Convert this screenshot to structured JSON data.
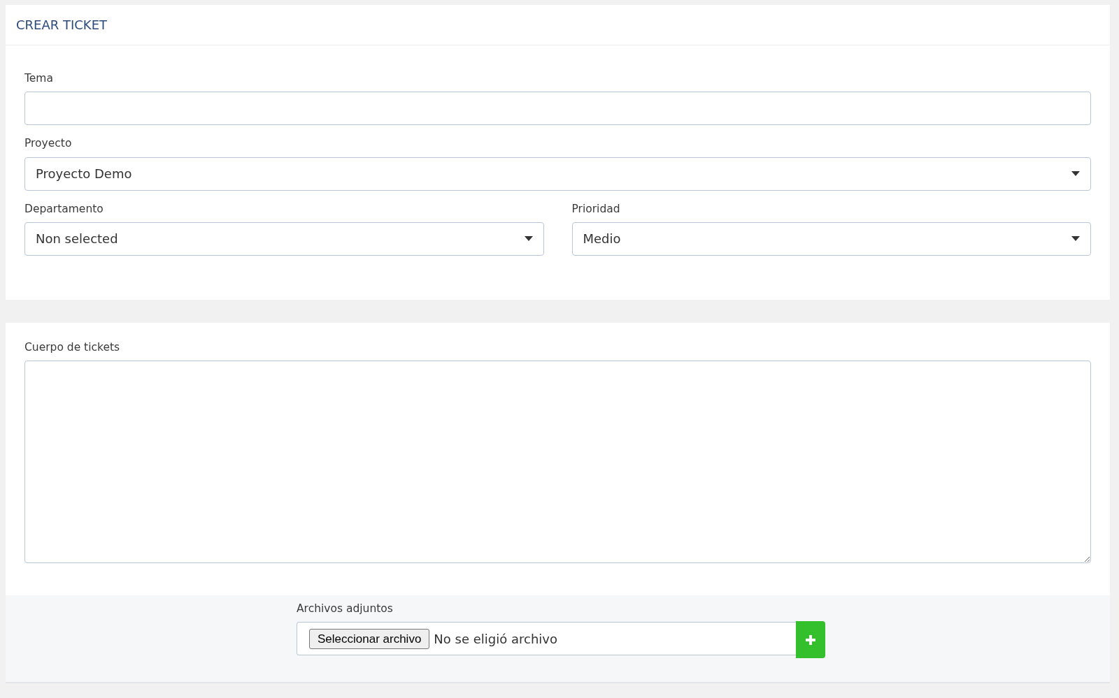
{
  "title": "CREAR TICKET",
  "rows": [
    [
      {
        "kind": "input",
        "label": "Tema"
      }
    ],
    [
      {
        "kind": "select",
        "label": "Proyecto",
        "value": "Proyecto Demo"
      }
    ],
    [
      {
        "kind": "select",
        "label": "Departamento",
        "value": "Non selected"
      },
      {
        "kind": "select",
        "label": "Prioridad",
        "value": "Medio"
      }
    ]
  ],
  "body": {
    "label": "Cuerpo de tickets"
  },
  "attachments": {
    "label": "Archivos adjuntos",
    "button": "Seleccionar archivo",
    "status": "No se eligió archivo"
  }
}
